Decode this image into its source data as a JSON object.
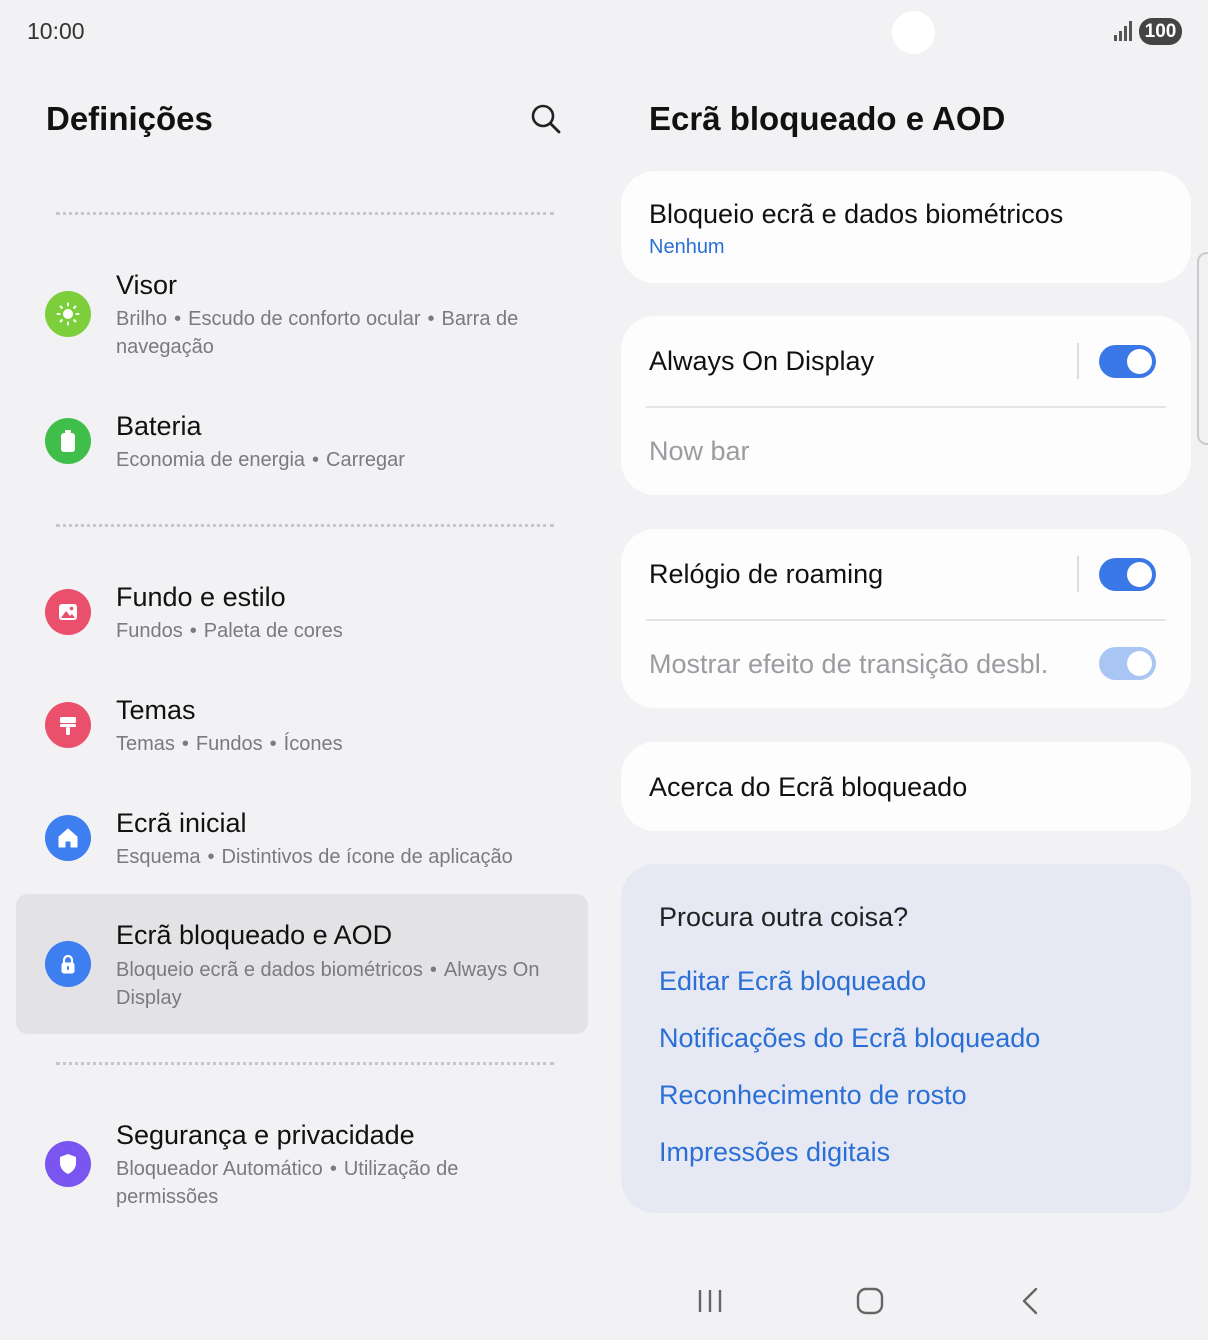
{
  "status": {
    "time": "10:00",
    "battery": "100"
  },
  "left": {
    "title": "Definições",
    "items": [
      {
        "title": "Visor",
        "sub": [
          "Brilho",
          "Escudo de conforto ocular",
          "Barra de navegação"
        ]
      },
      {
        "title": "Bateria",
        "sub": [
          "Economia de energia",
          "Carregar"
        ]
      },
      {
        "title": "Fundo e estilo",
        "sub": [
          "Fundos",
          "Paleta de cores"
        ]
      },
      {
        "title": "Temas",
        "sub": [
          "Temas",
          "Fundos",
          "Ícones"
        ]
      },
      {
        "title": "Ecrã inicial",
        "sub": [
          "Esquema",
          "Distintivos de ícone de aplicação"
        ]
      },
      {
        "title": "Ecrã bloqueado e AOD",
        "sub": [
          "Bloqueio ecrã e dados biométricos",
          "Always On Display"
        ]
      },
      {
        "title": "Segurança e privacidade",
        "sub": [
          "Bloqueador Automático",
          "Utilização de permissões"
        ]
      }
    ],
    "separator": "•"
  },
  "right": {
    "title": "Ecrã bloqueado e AOD",
    "lock": {
      "title": "Bloqueio ecrã e dados biométricos",
      "value": "Nenhum"
    },
    "aod": {
      "title": "Always On Display",
      "enabled": true,
      "nowbar": "Now bar"
    },
    "roaming": {
      "title": "Relógio de roaming",
      "enabled": true,
      "transition": "Mostrar efeito de transição desbl.",
      "transition_enabled": true
    },
    "about": "Acerca do Ecrã bloqueado",
    "suggest": {
      "title": "Procura outra coisa?",
      "links": [
        "Editar Ecrã bloqueado",
        "Notificações do Ecrã bloqueado",
        "Reconhecimento de rosto",
        "Impressões digitais"
      ]
    }
  },
  "colors": {
    "accent": "#3b78e7",
    "link": "#2a6fd6",
    "visor": "#7ccf3b",
    "bateria": "#3fbf4a",
    "fundo": "#ea4f6c",
    "temas": "#ea4f6c",
    "inicial": "#3d7ef0",
    "bloqueado": "#3d7ef0",
    "seguranca": "#7a55f0"
  }
}
